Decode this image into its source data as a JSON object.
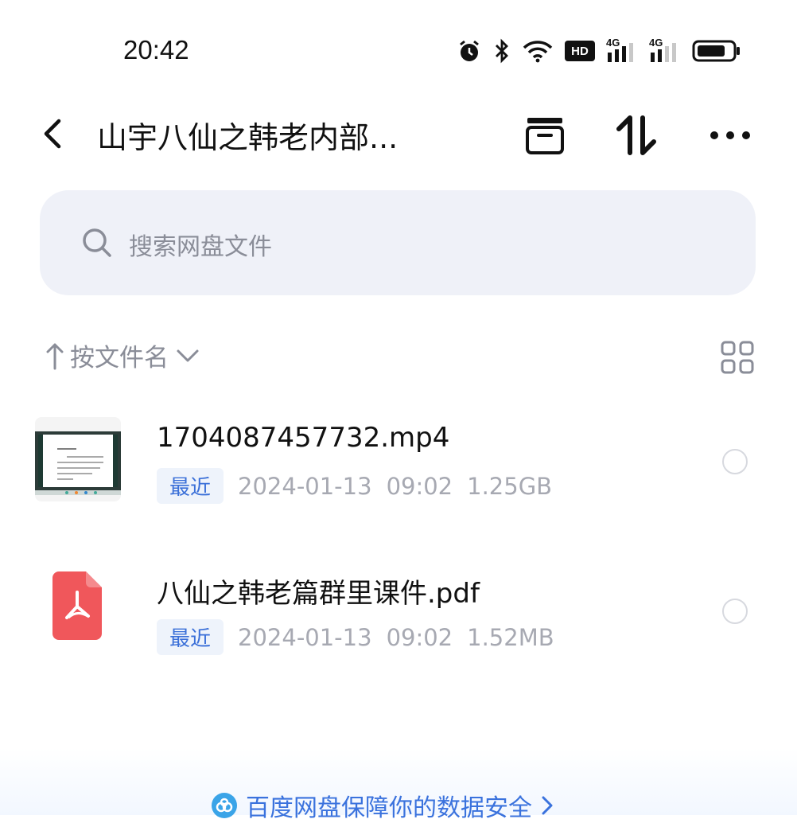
{
  "status_bar": {
    "time": "20:42",
    "icons": [
      "alarm-icon",
      "bluetooth-icon",
      "wifi-icon",
      "hd-icon",
      "signal-4g-icon",
      "signal-4g-icon",
      "battery-icon"
    ],
    "hd_label": "HD",
    "network_label": "4G"
  },
  "header": {
    "title": "山宇八仙之韩老内部...",
    "actions": [
      "archive-icon",
      "sort-icon",
      "more-icon"
    ]
  },
  "search": {
    "placeholder": "搜索网盘文件"
  },
  "sort": {
    "label": "按文件名"
  },
  "files": [
    {
      "name": "1704087457732.mp4",
      "badge": "最近",
      "date": "2024-01-13",
      "time": "09:02",
      "size": "1.25GB",
      "thumb": "video-thumbnail"
    },
    {
      "name": "八仙之韩老篇群里课件.pdf",
      "badge": "最近",
      "date": "2024-01-13",
      "time": "09:02",
      "size": "1.52MB",
      "thumb": "pdf-icon"
    }
  ],
  "footer": {
    "text": "百度网盘保障你的数据安全"
  },
  "colors": {
    "accent": "#3a72dd",
    "search_bg": "#eff1f8",
    "pdf_red": "#f0575b",
    "muted_text": "#a7a9b2"
  }
}
